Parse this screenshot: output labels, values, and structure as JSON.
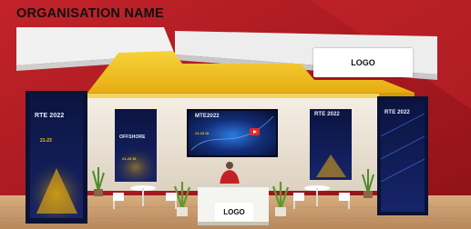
{
  "organisation_name": "ORGANISATION NAME",
  "logo_top": "LOGO",
  "logo_counter": "LOGO",
  "posters": {
    "left_banner": {
      "title": "RTE 2022",
      "dates": "21-23"
    },
    "left_panel": {
      "title": "OFFSHORE",
      "dates": "21-23 St"
    },
    "screen": {
      "title": "MTE2022",
      "dates": "21-23 St"
    },
    "right_panel": {
      "title": "RTE 2022"
    },
    "right_banner": {
      "title": "RTE 2022"
    }
  },
  "colors": {
    "background": "#b81c22",
    "canopy": "#f3c419",
    "canopy_edge": "#e0a90e",
    "fascia": "#eeeeee",
    "wall": "#ece4d8",
    "poster": "#0f1a4a",
    "floor": "#c79a6c",
    "counter": "#f4f4f0",
    "accent": "#f1c21b"
  }
}
